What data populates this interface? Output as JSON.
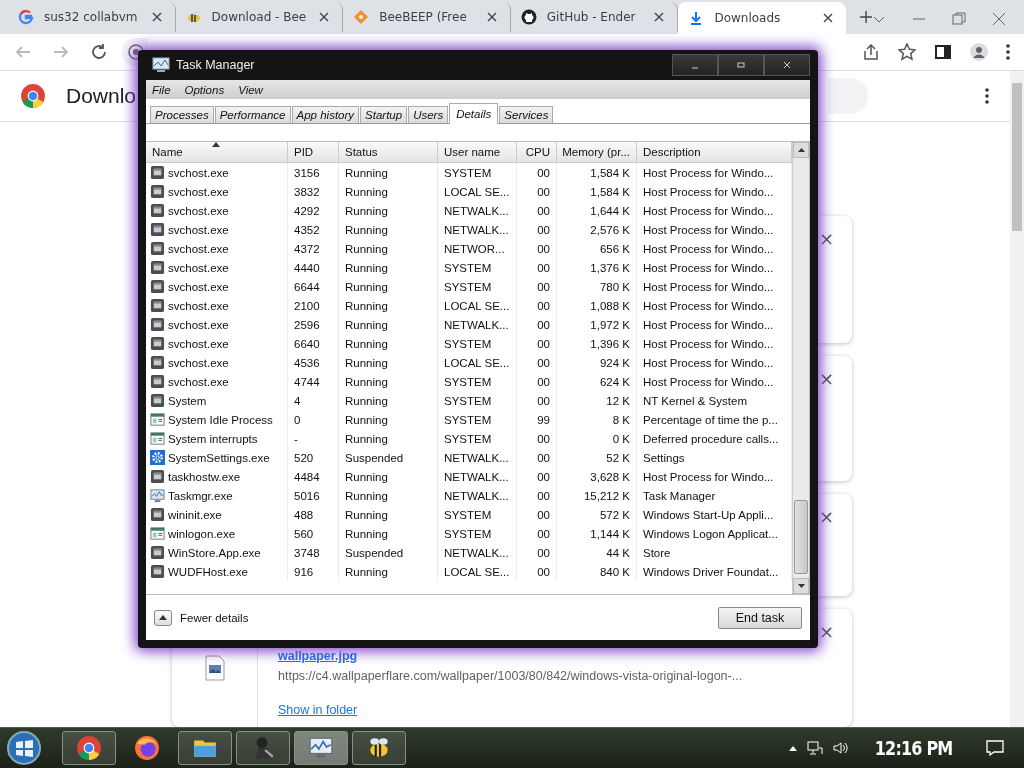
{
  "browser": {
    "tabs": [
      {
        "title": "sus32 collabvm",
        "kind": "google",
        "selected": false
      },
      {
        "title": "Download - Bee",
        "kind": "bee",
        "selected": false
      },
      {
        "title": "BeeBEEP (Free",
        "kind": "diamond",
        "selected": false
      },
      {
        "title": "GitHub - Ender",
        "kind": "github",
        "selected": false
      },
      {
        "title": "Downloads",
        "kind": "download",
        "selected": true
      }
    ],
    "page": {
      "heading": "Downlo",
      "downloads": [
        {
          "kind": "covered",
          "close": "×"
        },
        {
          "kind": "covered",
          "close": "×"
        },
        {
          "kind": "covered",
          "close": "×"
        },
        {
          "kind": "file",
          "close": "×",
          "file": "wallpaper.jpg",
          "url": "https://c4.wallpaperflare.com/wallpaper/1003/80/842/windows-vista-original-logon-...",
          "action": "Show in folder"
        }
      ]
    }
  },
  "task_manager": {
    "title": "Task Manager",
    "menu": [
      "File",
      "Options",
      "View"
    ],
    "tabs": [
      {
        "label": "Processes",
        "selected": false
      },
      {
        "label": "Performance",
        "selected": false
      },
      {
        "label": "App history",
        "selected": false
      },
      {
        "label": "Startup",
        "selected": false
      },
      {
        "label": "Users",
        "selected": false
      },
      {
        "label": "Details",
        "selected": true
      },
      {
        "label": "Services",
        "selected": false
      }
    ],
    "columns": [
      "Name",
      "PID",
      "Status",
      "User name",
      "CPU",
      "Memory (pr...",
      "Description"
    ],
    "rows": [
      {
        "kind": "service",
        "name": "svchost.exe",
        "pid": "3156",
        "status": "Running",
        "user": "SYSTEM",
        "cpu": "00",
        "memory": "1,584 K",
        "description": "Host Process for Windo..."
      },
      {
        "kind": "service",
        "name": "svchost.exe",
        "pid": "3832",
        "status": "Running",
        "user": "LOCAL SE...",
        "cpu": "00",
        "memory": "1,584 K",
        "description": "Host Process for Windo..."
      },
      {
        "kind": "service",
        "name": "svchost.exe",
        "pid": "4292",
        "status": "Running",
        "user": "NETWALK...",
        "cpu": "00",
        "memory": "1,644 K",
        "description": "Host Process for Windo..."
      },
      {
        "kind": "service",
        "name": "svchost.exe",
        "pid": "4352",
        "status": "Running",
        "user": "NETWALK...",
        "cpu": "00",
        "memory": "2,576 K",
        "description": "Host Process for Windo..."
      },
      {
        "kind": "service",
        "name": "svchost.exe",
        "pid": "4372",
        "status": "Running",
        "user": "NETWOR...",
        "cpu": "00",
        "memory": "656 K",
        "description": "Host Process for Windo..."
      },
      {
        "kind": "service",
        "name": "svchost.exe",
        "pid": "4440",
        "status": "Running",
        "user": "SYSTEM",
        "cpu": "00",
        "memory": "1,376 K",
        "description": "Host Process for Windo..."
      },
      {
        "kind": "service",
        "name": "svchost.exe",
        "pid": "6644",
        "status": "Running",
        "user": "SYSTEM",
        "cpu": "00",
        "memory": "780 K",
        "description": "Host Process for Windo..."
      },
      {
        "kind": "service",
        "name": "svchost.exe",
        "pid": "2100",
        "status": "Running",
        "user": "LOCAL SE...",
        "cpu": "00",
        "memory": "1,088 K",
        "description": "Host Process for Windo..."
      },
      {
        "kind": "service",
        "name": "svchost.exe",
        "pid": "2596",
        "status": "Running",
        "user": "NETWALK...",
        "cpu": "00",
        "memory": "1,972 K",
        "description": "Host Process for Windo..."
      },
      {
        "kind": "service",
        "name": "svchost.exe",
        "pid": "6640",
        "status": "Running",
        "user": "SYSTEM",
        "cpu": "00",
        "memory": "1,396 K",
        "description": "Host Process for Windo..."
      },
      {
        "kind": "service",
        "name": "svchost.exe",
        "pid": "4536",
        "status": "Running",
        "user": "LOCAL SE...",
        "cpu": "00",
        "memory": "924 K",
        "description": "Host Process for Windo..."
      },
      {
        "kind": "service",
        "name": "svchost.exe",
        "pid": "4744",
        "status": "Running",
        "user": "SYSTEM",
        "cpu": "00",
        "memory": "624 K",
        "description": "Host Process for Windo..."
      },
      {
        "kind": "service",
        "name": "System",
        "pid": "4",
        "status": "Running",
        "user": "SYSTEM",
        "cpu": "00",
        "memory": "12 K",
        "description": "NT Kernel & System"
      },
      {
        "kind": "window",
        "name": "System Idle Process",
        "pid": "0",
        "status": "Running",
        "user": "SYSTEM",
        "cpu": "99",
        "memory": "8 K",
        "description": "Percentage of time the p..."
      },
      {
        "kind": "window",
        "name": "System interrupts",
        "pid": "-",
        "status": "Running",
        "user": "SYSTEM",
        "cpu": "00",
        "memory": "0 K",
        "description": "Deferred procedure calls..."
      },
      {
        "kind": "gear",
        "name": "SystemSettings.exe",
        "pid": "520",
        "status": "Suspended",
        "user": "NETWALK...",
        "cpu": "00",
        "memory": "52 K",
        "description": "Settings"
      },
      {
        "kind": "service",
        "name": "taskhostw.exe",
        "pid": "4484",
        "status": "Running",
        "user": "NETWALK...",
        "cpu": "00",
        "memory": "3,628 K",
        "description": "Host Process for Windo..."
      },
      {
        "kind": "monitor",
        "name": "Taskmgr.exe",
        "pid": "5016",
        "status": "Running",
        "user": "NETWALK...",
        "cpu": "00",
        "memory": "15,212 K",
        "description": "Task Manager"
      },
      {
        "kind": "service",
        "name": "wininit.exe",
        "pid": "488",
        "status": "Running",
        "user": "SYSTEM",
        "cpu": "00",
        "memory": "572 K",
        "description": "Windows Start-Up Appli..."
      },
      {
        "kind": "window",
        "name": "winlogon.exe",
        "pid": "560",
        "status": "Running",
        "user": "SYSTEM",
        "cpu": "00",
        "memory": "1,144 K",
        "description": "Windows Logon Applicat..."
      },
      {
        "kind": "service",
        "name": "WinStore.App.exe",
        "pid": "3748",
        "status": "Suspended",
        "user": "NETWALK...",
        "cpu": "00",
        "memory": "44 K",
        "description": "Store"
      },
      {
        "kind": "service",
        "name": "WUDFHost.exe",
        "pid": "916",
        "status": "Running",
        "user": "LOCAL SE...",
        "cpu": "00",
        "memory": "840 K",
        "description": "Windows Driver Foundat..."
      }
    ],
    "fewer_details": "Fewer details",
    "end_task": "End task"
  },
  "taskbar": {
    "apps": [
      {
        "kind": "chrome",
        "running": true,
        "selected": false
      },
      {
        "kind": "firefox",
        "running": false,
        "selected": false
      },
      {
        "kind": "folder",
        "running": true,
        "selected": false
      },
      {
        "kind": "figure",
        "running": true,
        "selected": false
      },
      {
        "kind": "taskmgr",
        "running": true,
        "selected": true
      },
      {
        "kind": "bee",
        "running": true,
        "selected": false
      }
    ],
    "clock": "12:16 PM"
  }
}
